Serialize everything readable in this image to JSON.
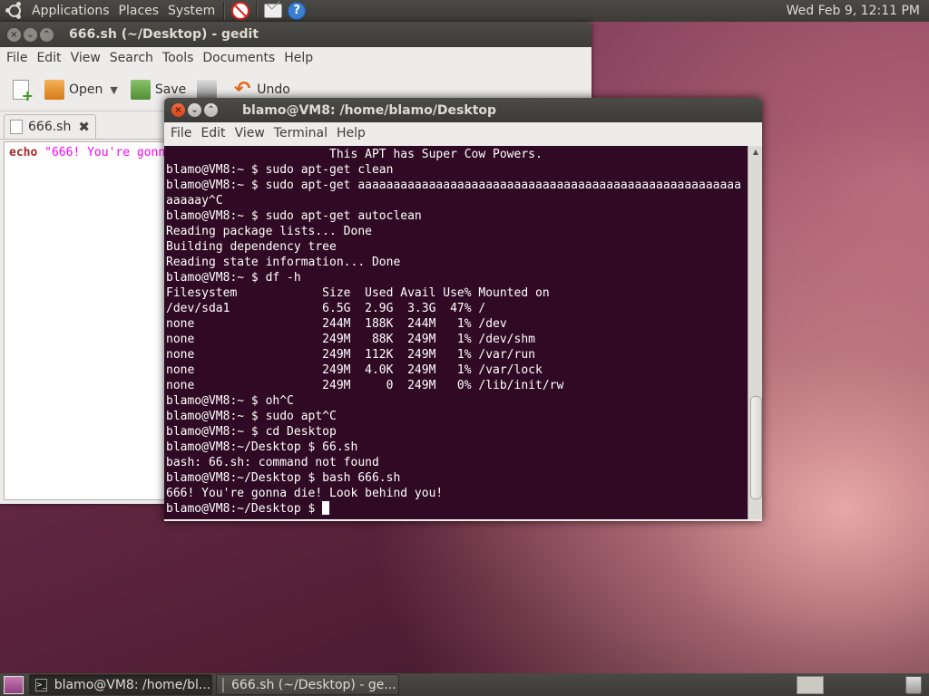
{
  "top_panel": {
    "menus": [
      "Applications",
      "Places",
      "System"
    ],
    "clock": "Wed Feb  9, 12:11 PM",
    "icons": [
      "ubuntu-logo",
      "no-entry-icon",
      "mail-icon",
      "help-icon"
    ]
  },
  "gedit": {
    "title": "666.sh (~/Desktop) - gedit",
    "menus": [
      "File",
      "Edit",
      "View",
      "Search",
      "Tools",
      "Documents",
      "Help"
    ],
    "toolbar": {
      "open_label": "Open",
      "save_label": "Save",
      "undo_label": "Undo"
    },
    "tab_label": "666.sh",
    "editor": {
      "keyword": "echo",
      "string": " \"666! You're gonn"
    }
  },
  "terminal": {
    "title": "blamo@VM8: /home/blamo/Desktop",
    "menus": [
      "File",
      "Edit",
      "View",
      "Terminal",
      "Help"
    ],
    "lines": [
      "                       This APT has Super Cow Powers.",
      "blamo@VM8:~ $ sudo apt-get clean",
      "blamo@VM8:~ $ sudo apt-get aaaaaaaaaaaaaaaaaaaaaaaaaaaaaaaaaaaaaaaaaaaaaaaaaaaaaa",
      "aaaaay^C",
      "blamo@VM8:~ $ sudo apt-get autoclean",
      "Reading package lists... Done",
      "Building dependency tree",
      "Reading state information... Done",
      "blamo@VM8:~ $ df -h",
      "Filesystem            Size  Used Avail Use% Mounted on",
      "/dev/sda1             6.5G  2.9G  3.3G  47% /",
      "none                  244M  188K  244M   1% /dev",
      "none                  249M   88K  249M   1% /dev/shm",
      "none                  249M  112K  249M   1% /var/run",
      "none                  249M  4.0K  249M   1% /var/lock",
      "none                  249M     0  249M   0% /lib/init/rw",
      "blamo@VM8:~ $ oh^C",
      "blamo@VM8:~ $ sudo apt^C",
      "blamo@VM8:~ $ cd Desktop",
      "blamo@VM8:~/Desktop $ 66.sh",
      "bash: 66.sh: command not found",
      "blamo@VM8:~/Desktop $ bash 666.sh",
      "666! You're gonna die! Look behind you!"
    ],
    "prompt": "blamo@VM8:~/Desktop $ "
  },
  "bottom_panel": {
    "tasks": [
      "blamo@VM8: /home/bl...",
      "666.sh (~/Desktop) - ge..."
    ]
  }
}
